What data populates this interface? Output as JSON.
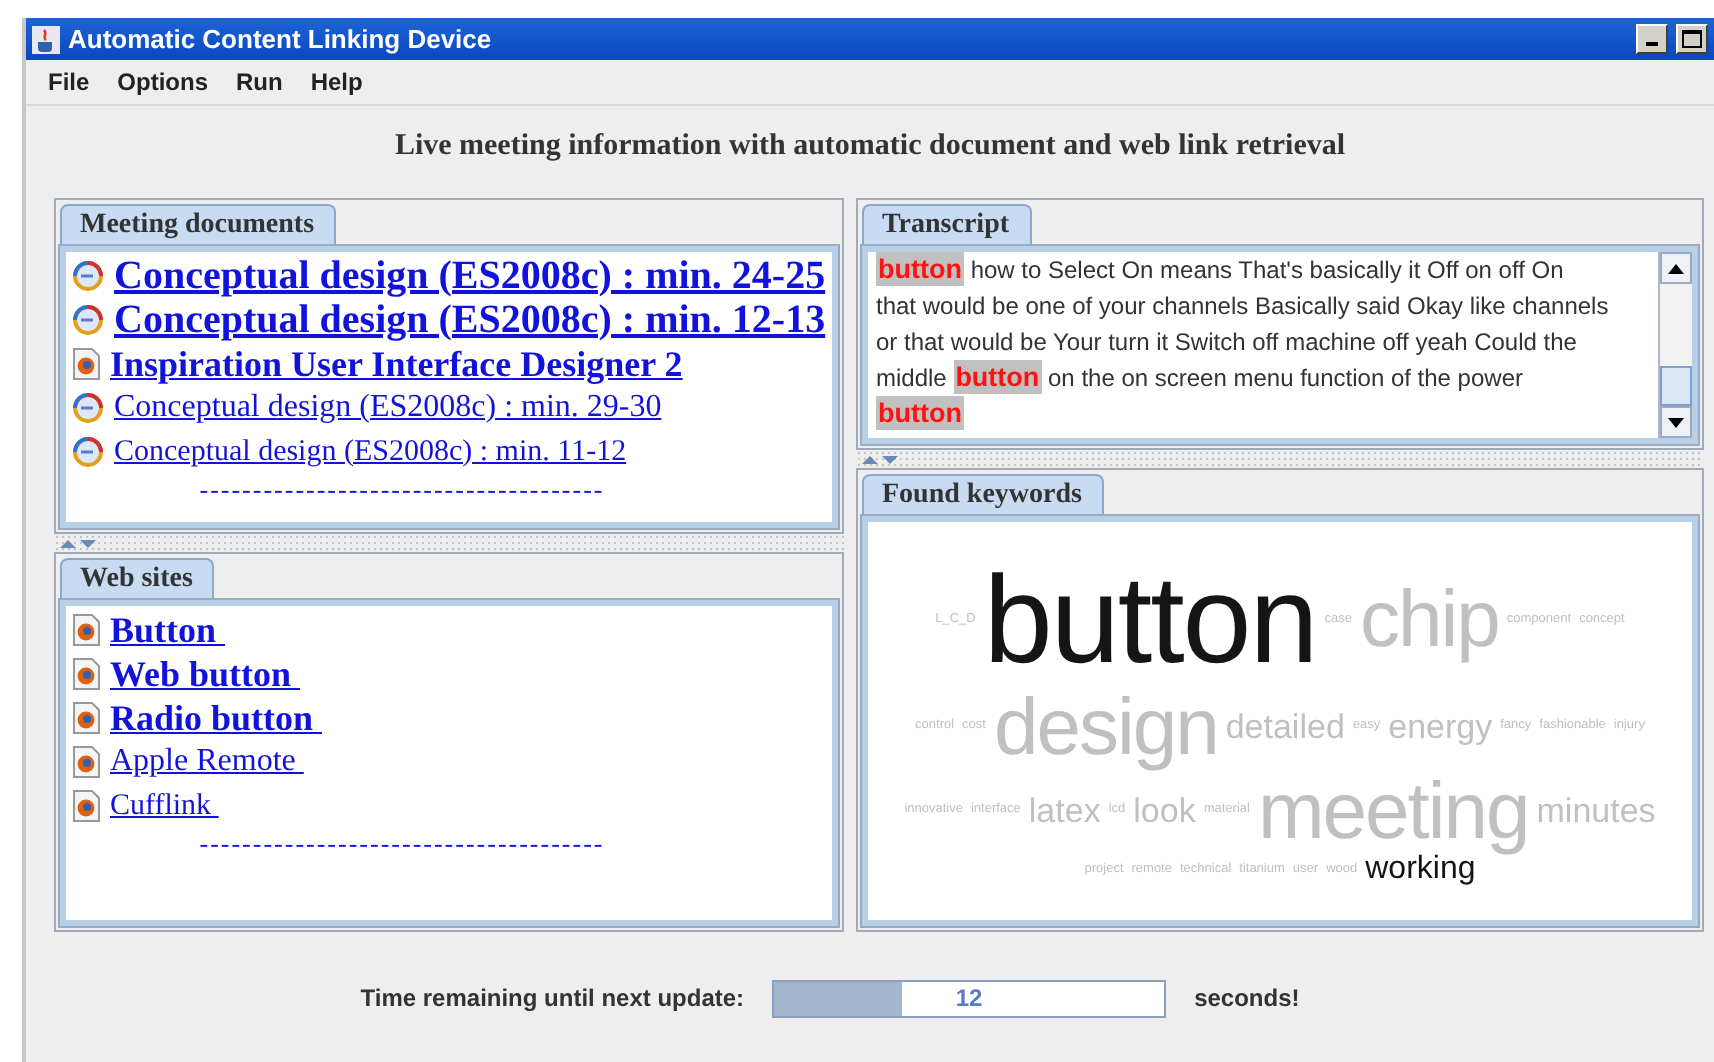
{
  "window": {
    "title": "Automatic Content Linking Device"
  },
  "menu": [
    "File",
    "Options",
    "Run",
    "Help"
  ],
  "headline": "Live meeting information with automatic document and web link retrieval",
  "documents": {
    "tab": "Meeting documents",
    "items": [
      {
        "label": "Conceptual design (ES2008c) : min. 24-25",
        "kind": "meeting"
      },
      {
        "label": "Conceptual design (ES2008c) : min. 12-13",
        "kind": "meeting"
      },
      {
        "label": "Inspiration User Interface Designer 2",
        "kind": "web"
      },
      {
        "label": "Conceptual design (ES2008c) : min. 29-30",
        "kind": "meeting"
      },
      {
        "label": "Conceptual design (ES2008c) : min. 11-12",
        "kind": "meeting"
      }
    ],
    "separator": "--------------------------------------"
  },
  "websites": {
    "tab": "Web sites",
    "items": [
      {
        "label": "Button ",
        "kind": "web"
      },
      {
        "label": "Web button ",
        "kind": "web"
      },
      {
        "label": "Radio button ",
        "kind": "web"
      },
      {
        "label": "Apple Remote ",
        "kind": "web"
      },
      {
        "label": "Cufflink ",
        "kind": "web"
      }
    ],
    "separator": "--------------------------------------"
  },
  "transcript": {
    "tab": "Transcript",
    "segments": [
      {
        "text": "button",
        "highlighted": true
      },
      {
        "text": " how to Select On means That's basically it Off on off On that would be one of your channels Basically said Okay like channels or that would be Your turn it Switch off machine off yeah Could the middle ",
        "highlighted": false
      },
      {
        "text": "button",
        "highlighted": true
      },
      {
        "text": " on the on screen menu function of the power ",
        "highlighted": false
      },
      {
        "text": "button",
        "highlighted": true
      }
    ]
  },
  "keywords": {
    "tab": "Found keywords",
    "lines": [
      {
        "words": [
          {
            "word": "L_C_D",
            "kind": "tiny",
            "highlighted": false
          },
          {
            "word": "button",
            "kind": "huge",
            "highlighted": true
          },
          {
            "word": "case",
            "kind": "tiny",
            "highlighted": false
          },
          {
            "word": "chip",
            "kind": "large",
            "highlighted": false
          },
          {
            "word": "component",
            "kind": "tiny",
            "highlighted": false
          },
          {
            "word": "concept",
            "kind": "tiny",
            "highlighted": false
          }
        ]
      },
      {
        "words": [
          {
            "word": "control",
            "kind": "tiny",
            "highlighted": false
          },
          {
            "word": "cost",
            "kind": "tiny",
            "highlighted": false
          },
          {
            "word": "design",
            "kind": "large",
            "highlighted": false
          },
          {
            "word": "detailed",
            "kind": "medium",
            "highlighted": false
          },
          {
            "word": "easy",
            "kind": "tiny",
            "highlighted": false
          },
          {
            "word": "energy",
            "kind": "medium",
            "highlighted": false
          },
          {
            "word": "fancy",
            "kind": "tiny",
            "highlighted": false
          },
          {
            "word": "fashionable",
            "kind": "tiny",
            "highlighted": false
          },
          {
            "word": "injury",
            "kind": "tiny",
            "highlighted": false
          }
        ]
      },
      {
        "words": [
          {
            "word": "innovative",
            "kind": "tiny",
            "highlighted": false
          },
          {
            "word": "interface",
            "kind": "tiny",
            "highlighted": false
          },
          {
            "word": "latex",
            "kind": "medium",
            "highlighted": false
          },
          {
            "word": "lcd",
            "kind": "tiny",
            "highlighted": false
          },
          {
            "word": "look",
            "kind": "medium",
            "highlighted": false
          },
          {
            "word": "material",
            "kind": "tiny",
            "highlighted": false
          },
          {
            "word": "meeting",
            "kind": "large",
            "highlighted": false
          },
          {
            "word": "minutes",
            "kind": "medium",
            "highlighted": false
          }
        ]
      },
      {
        "words": [
          {
            "word": "project",
            "kind": "tiny",
            "highlighted": false
          },
          {
            "word": "remote",
            "kind": "tiny",
            "highlighted": false
          },
          {
            "word": "technical",
            "kind": "tiny",
            "highlighted": false
          },
          {
            "word": "titanium",
            "kind": "tiny",
            "highlighted": false
          },
          {
            "word": "user",
            "kind": "tiny",
            "highlighted": false
          },
          {
            "word": "wood",
            "kind": "tiny",
            "highlighted": false
          },
          {
            "word": "working",
            "kind": "small",
            "highlighted": true
          }
        ]
      }
    ]
  },
  "status": {
    "label": "Time remaining until next update:",
    "value": "12",
    "level": 0.33,
    "unit": "seconds!"
  }
}
